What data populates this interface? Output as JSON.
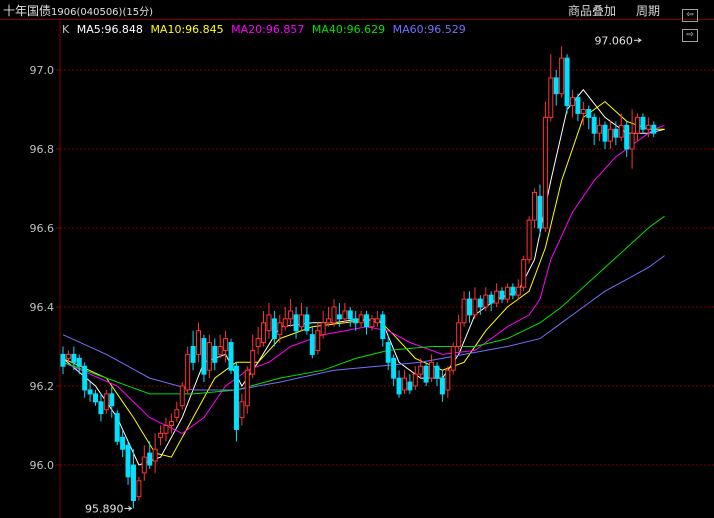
{
  "header": {
    "title_name": "十年国债",
    "title_code": "1906(040506)(15分)",
    "overlay_button": "商品叠加",
    "period_button": "周期",
    "nav_left": "⇦",
    "nav_right": "⇨"
  },
  "legend": {
    "k_label": "K",
    "ma5": "MA5:96.848",
    "ma10": "MA10:96.845",
    "ma20": "MA20:96.857",
    "ma40": "MA40:96.629",
    "ma60": "MA60:96.529"
  },
  "colors": {
    "background": "#000000",
    "grid": "#800000",
    "up": "#ff3232",
    "down": "#00e0ff",
    "ma5": "#ffffff",
    "ma10": "#ffff00",
    "ma20": "#ff00ff",
    "ma40": "#00e000",
    "ma60": "#7070ff"
  },
  "chart_data": {
    "type": "candlestick",
    "ylim": [
      95.87,
      97.12
    ],
    "y_ticks": [
      "97.0",
      "96.8",
      "96.6",
      "96.4",
      "96.2",
      "96.0"
    ],
    "y_tick_values": [
      97.0,
      96.8,
      96.6,
      96.4,
      96.2,
      96.0
    ],
    "annotations": [
      {
        "text": "97.060",
        "value": 97.06,
        "bar": 107
      },
      {
        "text": "95.890",
        "value": 95.89,
        "bar": 13
      }
    ],
    "candles": [
      [
        96.28,
        96.25,
        96.3,
        96.23
      ],
      [
        96.27,
        96.28,
        96.29,
        96.26
      ],
      [
        96.28,
        96.26,
        96.3,
        96.24
      ],
      [
        96.27,
        96.25,
        96.28,
        96.23
      ],
      [
        96.25,
        96.19,
        96.26,
        96.17
      ],
      [
        96.19,
        96.18,
        96.21,
        96.16
      ],
      [
        96.18,
        96.16,
        96.19,
        96.15
      ],
      [
        96.16,
        96.13,
        96.18,
        96.11
      ],
      [
        96.14,
        96.18,
        96.19,
        96.13
      ],
      [
        96.18,
        96.15,
        96.2,
        96.12
      ],
      [
        96.13,
        96.06,
        96.14,
        96.05
      ],
      [
        96.07,
        96.04,
        96.09,
        96.02
      ],
      [
        96.05,
        95.97,
        96.06,
        95.95
      ],
      [
        96.0,
        95.91,
        96.04,
        95.89
      ],
      [
        95.92,
        95.96,
        95.97,
        95.91
      ],
      [
        95.98,
        96.02,
        96.05,
        95.96
      ],
      [
        96.03,
        96.0,
        96.06,
        95.99
      ],
      [
        96.01,
        96.04,
        96.08,
        95.98
      ],
      [
        96.07,
        96.08,
        96.1,
        96.05
      ],
      [
        96.08,
        96.1,
        96.12,
        96.06
      ],
      [
        96.1,
        96.11,
        96.13,
        96.08
      ],
      [
        96.12,
        96.14,
        96.16,
        96.11
      ],
      [
        96.15,
        96.2,
        96.21,
        96.14
      ],
      [
        96.19,
        96.28,
        96.3,
        96.18
      ],
      [
        96.3,
        96.26,
        96.34,
        96.24
      ],
      [
        96.28,
        96.34,
        96.36,
        96.26
      ],
      [
        96.32,
        96.23,
        96.33,
        96.21
      ],
      [
        96.24,
        96.31,
        96.33,
        96.22
      ],
      [
        96.3,
        96.26,
        96.32,
        96.24
      ],
      [
        96.28,
        96.3,
        96.33,
        96.27
      ],
      [
        96.29,
        96.32,
        96.34,
        96.26
      ],
      [
        96.31,
        96.24,
        96.32,
        96.23
      ],
      [
        96.25,
        96.09,
        96.26,
        96.06
      ],
      [
        96.12,
        96.16,
        96.18,
        96.1
      ],
      [
        96.15,
        96.24,
        96.25,
        96.13
      ],
      [
        96.23,
        96.29,
        96.33,
        96.22
      ],
      [
        96.3,
        96.32,
        96.35,
        96.28
      ],
      [
        96.31,
        96.36,
        96.39,
        96.3
      ],
      [
        96.34,
        96.38,
        96.41,
        96.32
      ],
      [
        96.37,
        96.32,
        96.39,
        96.3
      ],
      [
        96.33,
        96.36,
        96.38,
        96.31
      ],
      [
        96.35,
        96.37,
        96.4,
        96.34
      ],
      [
        96.37,
        96.39,
        96.42,
        96.35
      ],
      [
        96.38,
        96.34,
        96.4,
        96.32
      ],
      [
        96.35,
        96.38,
        96.41,
        96.34
      ],
      [
        96.38,
        96.34,
        96.4,
        96.33
      ],
      [
        96.33,
        96.28,
        96.35,
        96.27
      ],
      [
        96.29,
        96.34,
        96.36,
        96.28
      ],
      [
        96.33,
        96.36,
        96.39,
        96.32
      ],
      [
        96.36,
        96.37,
        96.4,
        96.35
      ],
      [
        96.36,
        96.4,
        96.42,
        96.35
      ],
      [
        96.38,
        96.37,
        96.41,
        96.35
      ],
      [
        96.37,
        96.39,
        96.41,
        96.36
      ],
      [
        96.39,
        96.37,
        96.4,
        96.35
      ],
      [
        96.37,
        96.36,
        96.39,
        96.34
      ],
      [
        96.36,
        96.38,
        96.39,
        96.35
      ],
      [
        96.38,
        96.35,
        96.39,
        96.33
      ],
      [
        96.35,
        96.37,
        96.38,
        96.34
      ],
      [
        96.36,
        96.37,
        96.39,
        96.35
      ],
      [
        96.38,
        96.32,
        96.39,
        96.3
      ],
      [
        96.31,
        96.26,
        96.33,
        96.24
      ],
      [
        96.27,
        96.22,
        96.28,
        96.2
      ],
      [
        96.22,
        96.18,
        96.24,
        96.17
      ],
      [
        96.19,
        96.22,
        96.24,
        96.18
      ],
      [
        96.21,
        96.19,
        96.23,
        96.18
      ],
      [
        96.2,
        96.23,
        96.25,
        96.19
      ],
      [
        96.23,
        96.25,
        96.27,
        96.22
      ],
      [
        96.25,
        96.21,
        96.26,
        96.2
      ],
      [
        96.22,
        96.26,
        96.28,
        96.21
      ],
      [
        96.25,
        96.22,
        96.26,
        96.2
      ],
      [
        96.22,
        96.18,
        96.24,
        96.16
      ],
      [
        96.19,
        96.24,
        96.25,
        96.17
      ],
      [
        96.24,
        96.3,
        96.31,
        96.23
      ],
      [
        96.3,
        96.36,
        96.38,
        96.29
      ],
      [
        96.36,
        96.42,
        96.44,
        96.35
      ],
      [
        96.42,
        96.38,
        96.44,
        96.36
      ],
      [
        96.38,
        96.42,
        96.45,
        96.37
      ],
      [
        96.42,
        96.4,
        96.43,
        96.38
      ],
      [
        96.4,
        96.43,
        96.45,
        96.39
      ],
      [
        96.43,
        96.41,
        96.44,
        96.39
      ],
      [
        96.41,
        96.44,
        96.46,
        96.4
      ],
      [
        96.44,
        96.42,
        96.45,
        96.41
      ],
      [
        96.42,
        96.45,
        96.46,
        96.41
      ],
      [
        96.45,
        96.43,
        96.46,
        96.42
      ],
      [
        96.43,
        96.45,
        96.47,
        96.42
      ],
      [
        96.45,
        96.52,
        96.53,
        96.44
      ],
      [
        96.52,
        96.62,
        96.63,
        96.51
      ],
      [
        96.62,
        96.69,
        96.7,
        96.6
      ],
      [
        96.68,
        96.6,
        96.71,
        96.58
      ],
      [
        96.6,
        96.88,
        96.92,
        96.59
      ],
      [
        96.88,
        96.98,
        97.04,
        96.87
      ],
      [
        96.98,
        96.94,
        97.0,
        96.91
      ],
      [
        96.94,
        97.03,
        97.06,
        96.93
      ],
      [
        97.03,
        96.91,
        97.04,
        96.89
      ],
      [
        96.91,
        96.93,
        96.95,
        96.88
      ],
      [
        96.93,
        96.89,
        96.94,
        96.87
      ],
      [
        96.89,
        96.9,
        96.92,
        96.86
      ],
      [
        96.9,
        96.88,
        96.91,
        96.85
      ],
      [
        96.88,
        96.84,
        96.89,
        96.81
      ],
      [
        96.84,
        96.86,
        96.88,
        96.82
      ],
      [
        96.86,
        96.82,
        96.87,
        96.8
      ],
      [
        96.82,
        96.85,
        96.87,
        96.8
      ],
      [
        96.85,
        96.83,
        96.87,
        96.81
      ],
      [
        96.83,
        96.86,
        96.89,
        96.82
      ],
      [
        96.86,
        96.8,
        96.87,
        96.78
      ],
      [
        96.8,
        96.84,
        96.9,
        96.75
      ],
      [
        96.84,
        96.88,
        96.89,
        96.82
      ],
      [
        96.88,
        96.85,
        96.89,
        96.84
      ],
      [
        96.85,
        96.86,
        96.88,
        96.83
      ],
      [
        96.86,
        96.84,
        96.87,
        96.83
      ]
    ],
    "ma_series": [
      {
        "name": "MA5",
        "color": "#ffffff",
        "values": [
          [
            0,
            96.27
          ],
          [
            6,
            96.2
          ],
          [
            10,
            96.12
          ],
          [
            14,
            96.0
          ],
          [
            18,
            96.02
          ],
          [
            22,
            96.12
          ],
          [
            26,
            96.26
          ],
          [
            30,
            96.28
          ],
          [
            33,
            96.2
          ],
          [
            36,
            96.26
          ],
          [
            40,
            96.35
          ],
          [
            46,
            96.36
          ],
          [
            50,
            96.36
          ],
          [
            55,
            96.37
          ],
          [
            59,
            96.36
          ],
          [
            62,
            96.26
          ],
          [
            66,
            96.22
          ],
          [
            70,
            96.22
          ],
          [
            73,
            96.28
          ],
          [
            76,
            96.38
          ],
          [
            80,
            96.42
          ],
          [
            84,
            96.44
          ],
          [
            87,
            96.52
          ],
          [
            90,
            96.72
          ],
          [
            93,
            96.9
          ],
          [
            96,
            96.95
          ],
          [
            100,
            96.88
          ],
          [
            104,
            96.84
          ],
          [
            108,
            96.84
          ],
          [
            111,
            96.85
          ]
        ]
      },
      {
        "name": "MA10",
        "color": "#ffff00",
        "values": [
          [
            0,
            96.27
          ],
          [
            8,
            96.22
          ],
          [
            13,
            96.12
          ],
          [
            17,
            96.03
          ],
          [
            20,
            96.02
          ],
          [
            24,
            96.12
          ],
          [
            28,
            96.22
          ],
          [
            32,
            96.26
          ],
          [
            36,
            96.26
          ],
          [
            40,
            96.32
          ],
          [
            46,
            96.35
          ],
          [
            52,
            96.36
          ],
          [
            58,
            96.37
          ],
          [
            61,
            96.33
          ],
          [
            65,
            96.27
          ],
          [
            70,
            96.24
          ],
          [
            74,
            96.26
          ],
          [
            78,
            96.34
          ],
          [
            82,
            96.4
          ],
          [
            86,
            96.44
          ],
          [
            89,
            96.55
          ],
          [
            92,
            96.72
          ],
          [
            96,
            96.88
          ],
          [
            100,
            96.92
          ],
          [
            104,
            96.87
          ],
          [
            108,
            96.85
          ],
          [
            111,
            96.85
          ]
        ]
      },
      {
        "name": "MA20",
        "color": "#ff00ff",
        "values": [
          [
            0,
            96.26
          ],
          [
            10,
            96.2
          ],
          [
            16,
            96.12
          ],
          [
            22,
            96.08
          ],
          [
            26,
            96.12
          ],
          [
            30,
            96.2
          ],
          [
            34,
            96.24
          ],
          [
            38,
            96.26
          ],
          [
            42,
            96.3
          ],
          [
            48,
            96.33
          ],
          [
            56,
            96.35
          ],
          [
            60,
            96.34
          ],
          [
            64,
            96.31
          ],
          [
            70,
            96.28
          ],
          [
            76,
            96.29
          ],
          [
            82,
            96.35
          ],
          [
            86,
            96.38
          ],
          [
            88,
            96.42
          ],
          [
            90,
            96.52
          ],
          [
            94,
            96.64
          ],
          [
            98,
            96.72
          ],
          [
            102,
            96.78
          ],
          [
            106,
            96.82
          ],
          [
            109,
            96.85
          ],
          [
            111,
            96.86
          ]
        ]
      },
      {
        "name": "MA40",
        "color": "#00e000",
        "values": [
          [
            0,
            96.26
          ],
          [
            8,
            96.22
          ],
          [
            16,
            96.18
          ],
          [
            24,
            96.18
          ],
          [
            32,
            96.19
          ],
          [
            40,
            96.22
          ],
          [
            48,
            96.24
          ],
          [
            54,
            96.27
          ],
          [
            60,
            96.29
          ],
          [
            68,
            96.3
          ],
          [
            76,
            96.3
          ],
          [
            82,
            96.32
          ],
          [
            88,
            96.36
          ],
          [
            92,
            96.4
          ],
          [
            96,
            96.45
          ],
          [
            100,
            96.5
          ],
          [
            104,
            96.55
          ],
          [
            108,
            96.6
          ],
          [
            111,
            96.63
          ]
        ]
      },
      {
        "name": "MA60",
        "color": "#7070ff",
        "values": [
          [
            0,
            96.33
          ],
          [
            8,
            96.28
          ],
          [
            16,
            96.22
          ],
          [
            24,
            96.19
          ],
          [
            32,
            96.19
          ],
          [
            40,
            96.21
          ],
          [
            50,
            96.24
          ],
          [
            58,
            96.25
          ],
          [
            66,
            96.26
          ],
          [
            74,
            96.28
          ],
          [
            82,
            96.3
          ],
          [
            88,
            96.32
          ],
          [
            92,
            96.36
          ],
          [
            96,
            96.4
          ],
          [
            100,
            96.44
          ],
          [
            104,
            96.47
          ],
          [
            108,
            96.5
          ],
          [
            111,
            96.53
          ]
        ]
      }
    ]
  }
}
